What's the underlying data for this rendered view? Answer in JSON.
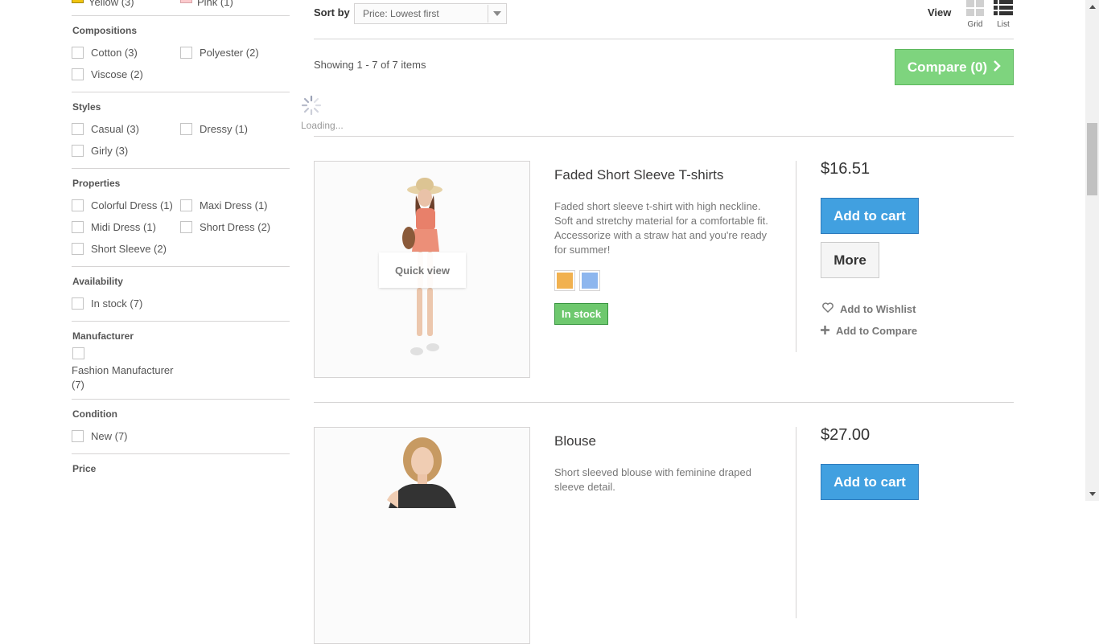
{
  "filters": {
    "color_row": [
      {
        "label": "Yellow (3)",
        "color": "#f1c40f"
      },
      {
        "label": "Pink (1)",
        "color": "#fccacd"
      }
    ],
    "compositions": {
      "title": "Compositions",
      "options": [
        "Cotton (3)",
        "Polyester (2)",
        "Viscose (2)"
      ]
    },
    "styles": {
      "title": "Styles",
      "options": [
        "Casual (3)",
        "Dressy (1)",
        "Girly (3)"
      ]
    },
    "properties": {
      "title": "Properties",
      "options": [
        "Colorful Dress (1)",
        "Maxi Dress (1)",
        "Midi Dress (1)",
        "Short Dress (2)",
        "Short Sleeve (2)"
      ]
    },
    "availability": {
      "title": "Availability",
      "options": [
        "In stock (7)"
      ]
    },
    "manufacturer": {
      "title": "Manufacturer",
      "options": [
        "Fashion Manufacturer (7)"
      ]
    },
    "condition": {
      "title": "Condition",
      "options": [
        "New (7)"
      ]
    },
    "price": {
      "title": "Price"
    }
  },
  "toolbar": {
    "sort_label": "Sort by",
    "sort_value": "Price: Lowest first",
    "view_label": "View",
    "grid_label": "Grid",
    "list_label": "List",
    "showing": "Showing 1 - 7 of 7 items",
    "compare_label": "Compare (0)",
    "loading": "Loading..."
  },
  "products": [
    {
      "name": "Faded Short Sleeve T-shirts",
      "description": "Faded short sleeve t-shirt with high neckline. Soft and stretchy material for a comfortable fit. Accessorize with a straw hat and you're ready for summer!",
      "price": "$16.51",
      "colors": [
        "#f1b14f",
        "#8db6ee"
      ],
      "availability": "In stock",
      "quick_view": "Quick view",
      "add_to_cart": "Add to cart",
      "more": "More",
      "wishlist": "Add to Wishlist",
      "compare": "Add to Compare"
    },
    {
      "name": "Blouse",
      "description": "Short sleeved blouse with feminine draped sleeve detail.",
      "price": "$27.00",
      "add_to_cart": "Add to cart"
    }
  ]
}
